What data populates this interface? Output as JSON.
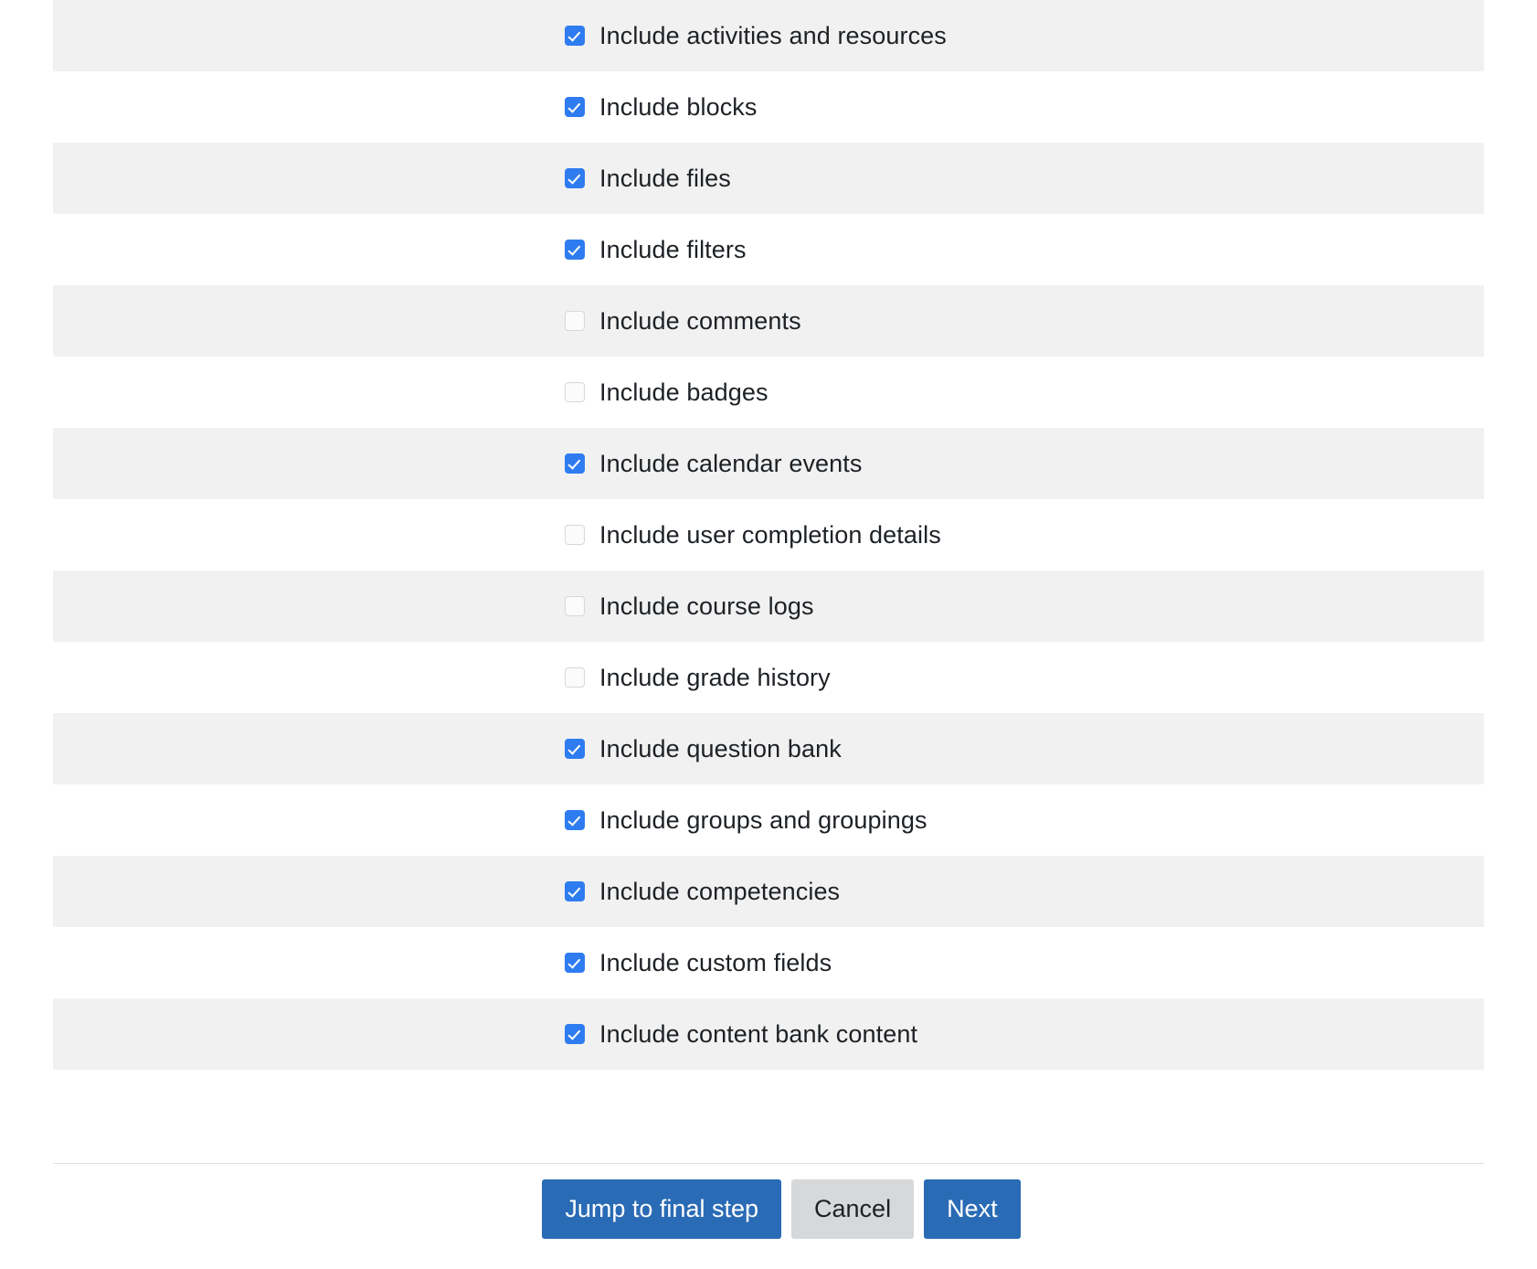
{
  "settings": {
    "items": [
      {
        "label": "Include activities and resources",
        "checked": true,
        "striped": true
      },
      {
        "label": "Include blocks",
        "checked": true,
        "striped": false
      },
      {
        "label": "Include files",
        "checked": true,
        "striped": true
      },
      {
        "label": "Include filters",
        "checked": true,
        "striped": false
      },
      {
        "label": "Include comments",
        "checked": false,
        "striped": true
      },
      {
        "label": "Include badges",
        "checked": false,
        "striped": false
      },
      {
        "label": "Include calendar events",
        "checked": true,
        "striped": true
      },
      {
        "label": "Include user completion details",
        "checked": false,
        "striped": false
      },
      {
        "label": "Include course logs",
        "checked": false,
        "striped": true
      },
      {
        "label": "Include grade history",
        "checked": false,
        "striped": false
      },
      {
        "label": "Include question bank",
        "checked": true,
        "striped": true
      },
      {
        "label": "Include groups and groupings",
        "checked": true,
        "striped": false
      },
      {
        "label": "Include competencies",
        "checked": true,
        "striped": true
      },
      {
        "label": "Include custom fields",
        "checked": true,
        "striped": false
      },
      {
        "label": "Include content bank content",
        "checked": true,
        "striped": true
      }
    ]
  },
  "footer": {
    "buttons": [
      {
        "label": "Jump to final step",
        "style": "primary"
      },
      {
        "label": "Cancel",
        "style": "secondary"
      },
      {
        "label": "Next",
        "style": "primary"
      }
    ]
  },
  "colors": {
    "checkbox_checked": "#2f7cf0",
    "checkbox_unchecked_border": "#d8d8d8",
    "row_stripe": "#f1f1f1",
    "button_primary": "#2a6bb5",
    "button_secondary": "#d6d8da",
    "text": "#1d2125",
    "separator": "#e2e2e2"
  }
}
